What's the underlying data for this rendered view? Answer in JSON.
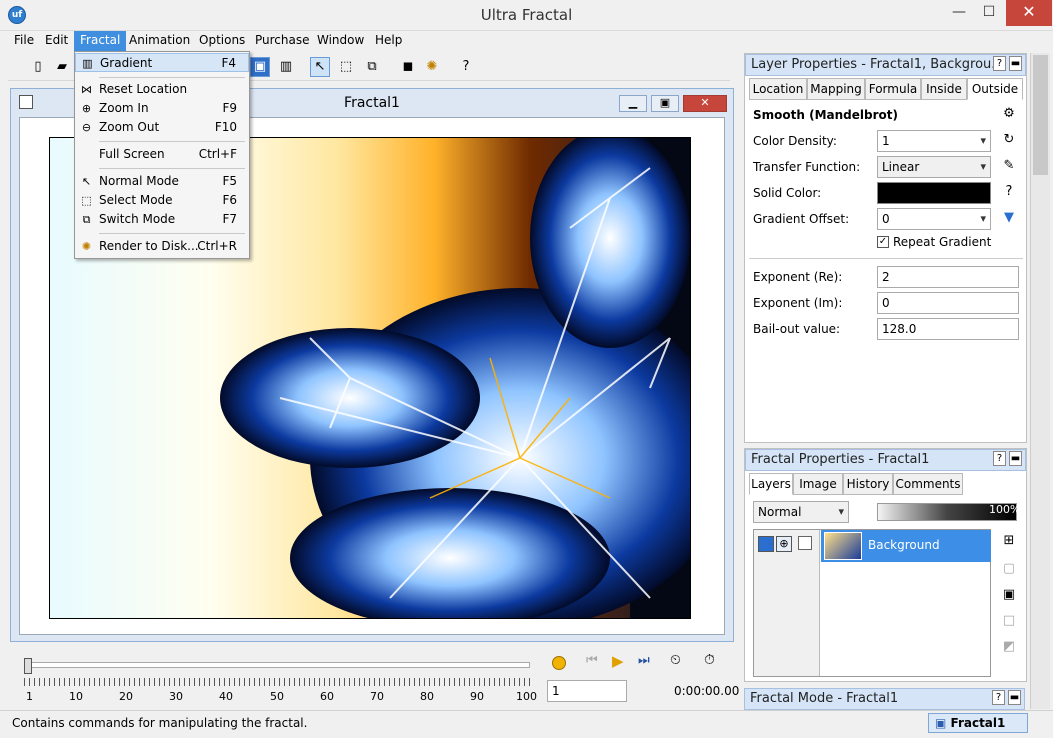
{
  "app": {
    "title": "Ultra Fractal",
    "icon_label": "uf"
  },
  "window_controls": {
    "minimize": "—",
    "maximize": "☐",
    "close": "✕"
  },
  "menubar": [
    "File",
    "Edit",
    "Fractal",
    "Animation",
    "Options",
    "Purchase",
    "Window",
    "Help"
  ],
  "fractal_menu": [
    {
      "label": "Gradient",
      "shortcut": "F4",
      "icon": "gradient-icon",
      "glyph": "▥"
    },
    {
      "label": "Reset Location",
      "shortcut": "",
      "icon": "reset-location-icon",
      "glyph": "⋈"
    },
    {
      "label": "Zoom In",
      "shortcut": "F9",
      "icon": "zoom-in-icon",
      "glyph": "⊕"
    },
    {
      "label": "Zoom Out",
      "shortcut": "F10",
      "icon": "zoom-out-icon",
      "glyph": "⊖"
    },
    {
      "label": "Full Screen",
      "shortcut": "Ctrl+F",
      "icon": "",
      "glyph": ""
    },
    {
      "label": "Normal Mode",
      "shortcut": "F5",
      "icon": "normal-mode-icon",
      "glyph": "↖"
    },
    {
      "label": "Select Mode",
      "shortcut": "F6",
      "icon": "select-mode-icon",
      "glyph": "⬚"
    },
    {
      "label": "Switch Mode",
      "shortcut": "F7",
      "icon": "switch-mode-icon",
      "glyph": "⧉"
    },
    {
      "label": "Render to Disk...",
      "shortcut": "Ctrl+R",
      "icon": "render-to-disk-icon",
      "glyph": "✺"
    }
  ],
  "toolbar": {
    "help_glyph": "?"
  },
  "fractal_window": {
    "title": "Fractal1",
    "min": "▁",
    "max": "▣",
    "close": "✕"
  },
  "timeline": {
    "ticks": [
      "1",
      "10",
      "20",
      "30",
      "40",
      "50",
      "60",
      "70",
      "80",
      "90",
      "100"
    ],
    "frame_value": "1",
    "time": "0:00:00.00"
  },
  "status": {
    "text": "Contains commands for manipulating the fractal.",
    "doc_tab": "Fractal1"
  },
  "layer_properties": {
    "title": "Layer Properties - Fractal1, Backgrou...",
    "tabs": [
      "Location",
      "Mapping",
      "Formula",
      "Inside",
      "Outside"
    ],
    "active_tab": "Outside",
    "section": "Smooth (Mandelbrot)",
    "color_density_label": "Color Density:",
    "color_density": "1",
    "transfer_label": "Transfer Function:",
    "transfer": "Linear",
    "solid_color_label": "Solid Color:",
    "solid_color": "#000000",
    "gradient_offset_label": "Gradient Offset:",
    "gradient_offset": "0",
    "repeat_gradient": "Repeat Gradient",
    "exp_re_label": "Exponent (Re):",
    "exp_re": "2",
    "exp_im_label": "Exponent (Im):",
    "exp_im": "0",
    "bailout_label": "Bail-out value:",
    "bailout": "128.0"
  },
  "fractal_properties": {
    "title": "Fractal Properties - Fractal1",
    "tabs": [
      "Layers",
      "Image",
      "History",
      "Comments"
    ],
    "active_tab": "Layers",
    "blend_mode": "Normal",
    "opacity": "100%",
    "layer_name": "Background"
  },
  "fractal_mode": {
    "title": "Fractal Mode - Fractal1"
  },
  "panel_buttons": {
    "help": "?",
    "close": "▬"
  }
}
